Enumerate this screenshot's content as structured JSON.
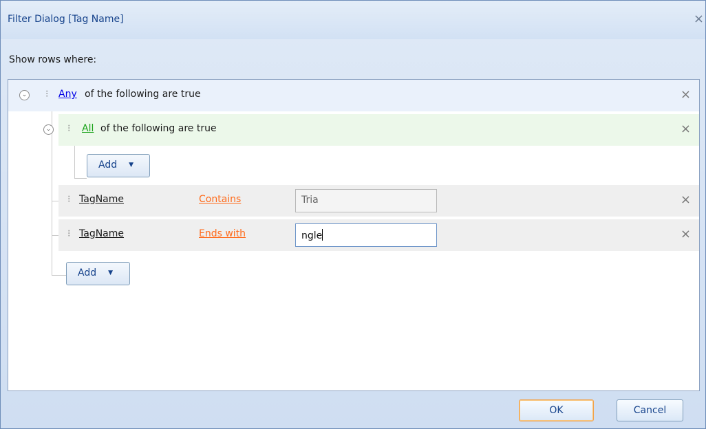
{
  "dialog": {
    "title": "Filter Dialog [Tag Name]",
    "subtitle": "Show rows where:",
    "close_glyph": "×"
  },
  "filter": {
    "any_group": {
      "toggle_icon": "collapse-icon",
      "operator": "Any",
      "text": "of the following are true"
    },
    "all_group": {
      "toggle_icon": "collapse-icon",
      "operator": "All",
      "text": "of the following are true"
    },
    "conditions": [
      {
        "field": "TagName",
        "operator": "Contains",
        "value": "Tria"
      },
      {
        "field": "TagName",
        "operator": "Ends with",
        "value": "ngle"
      }
    ],
    "add_button": "Add",
    "add_icon": "chevron-down-icon"
  },
  "buttons": {
    "ok": "OK",
    "cancel": "Cancel"
  },
  "colors": {
    "accent": "#15428b",
    "blue_link": "#0000e6",
    "green_link": "#19a319",
    "orange_link": "#ff6a1a",
    "focus": "#f1a24b"
  }
}
